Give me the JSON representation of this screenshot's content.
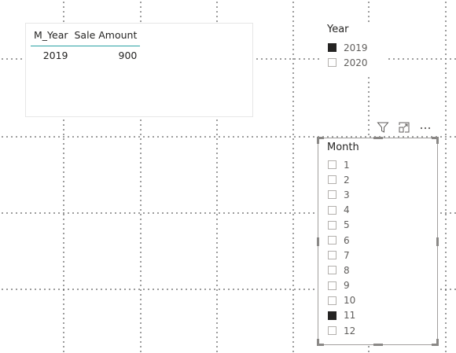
{
  "table": {
    "headers": [
      "M_Year",
      "Sale Amount"
    ],
    "rows": [
      [
        "2019",
        "900"
      ]
    ]
  },
  "year_slicer": {
    "title": "Year",
    "items": [
      {
        "label": "2019",
        "checked": true
      },
      {
        "label": "2020",
        "checked": false
      }
    ]
  },
  "month_slicer": {
    "title": "Month",
    "items": [
      {
        "label": "1",
        "checked": false
      },
      {
        "label": "2",
        "checked": false
      },
      {
        "label": "3",
        "checked": false
      },
      {
        "label": "4",
        "checked": false
      },
      {
        "label": "5",
        "checked": false
      },
      {
        "label": "6",
        "checked": false
      },
      {
        "label": "7",
        "checked": false
      },
      {
        "label": "8",
        "checked": false
      },
      {
        "label": "9",
        "checked": false
      },
      {
        "label": "10",
        "checked": false
      },
      {
        "label": "11",
        "checked": true
      },
      {
        "label": "12",
        "checked": false
      }
    ]
  },
  "toolbar": {
    "icons": [
      "filter-icon",
      "focus-mode-icon",
      "more-options-icon"
    ]
  },
  "colors": {
    "header_underline": "#2aa1a4",
    "checked": "#252423",
    "text": "#252423",
    "item_text": "#605e5c"
  }
}
